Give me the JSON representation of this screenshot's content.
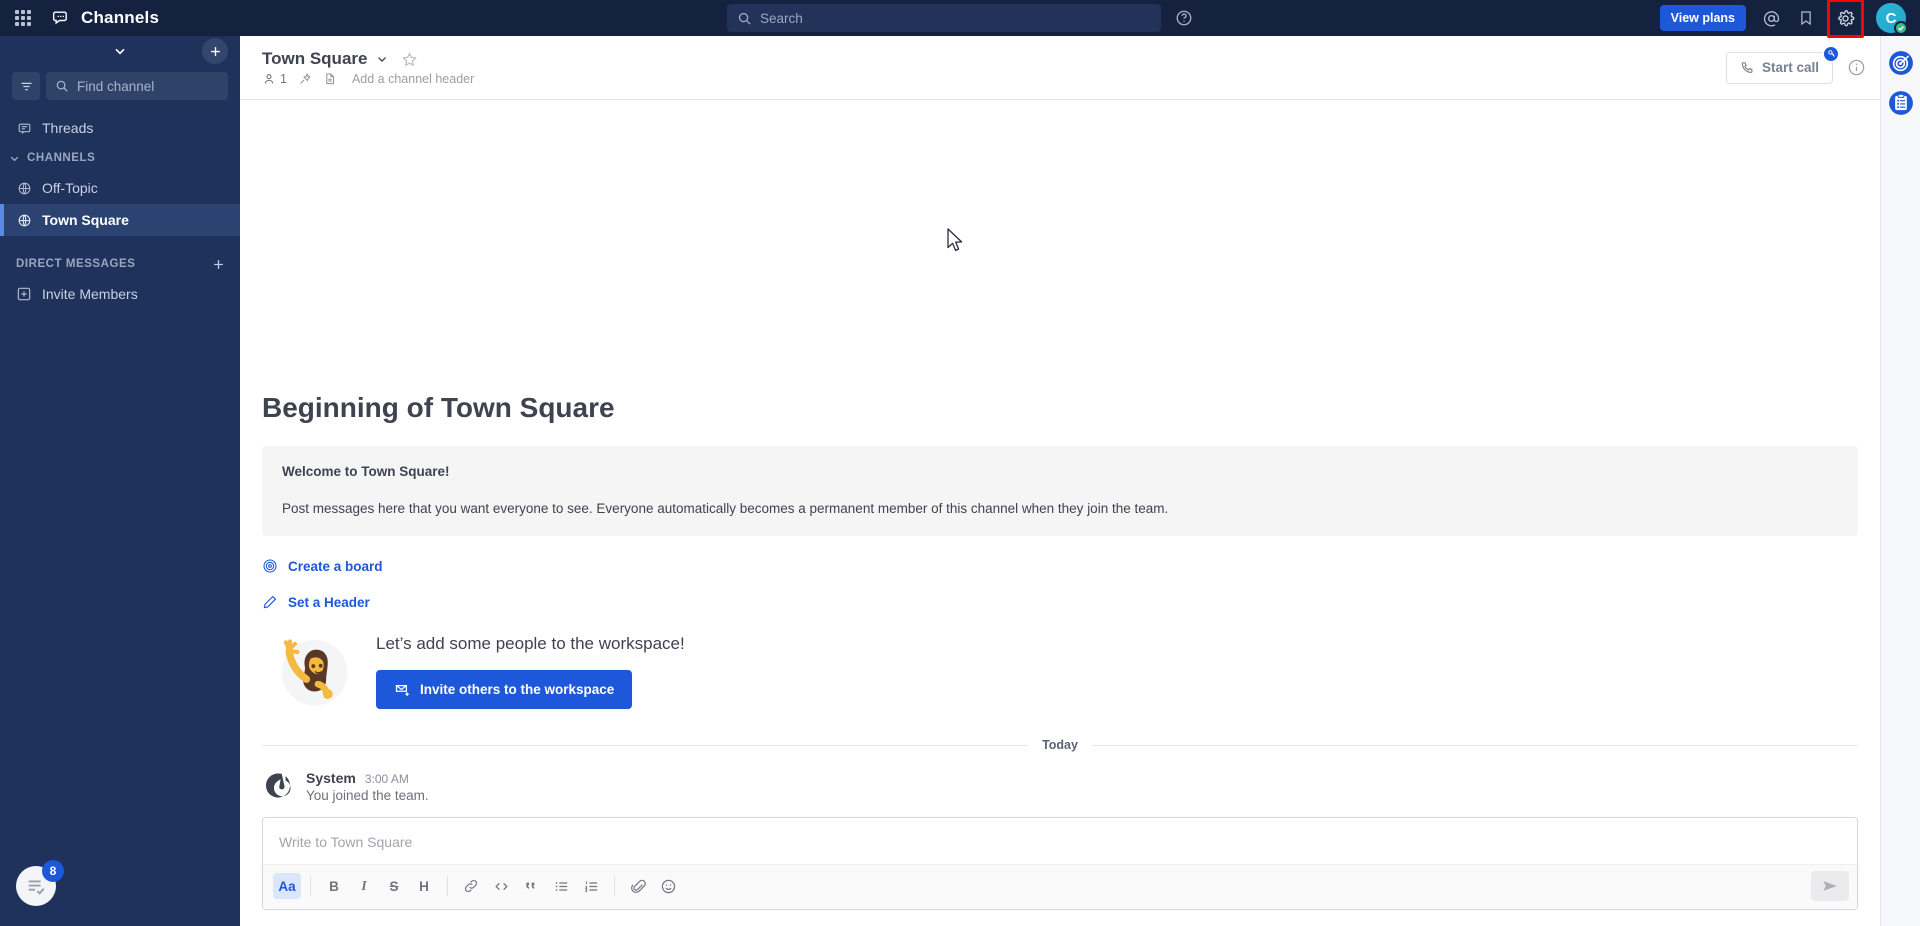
{
  "global_header": {
    "product_name": "Channels",
    "grid_icon": "apps-grid-icon",
    "product_icon": "channels-icon",
    "search_placeholder": "Search",
    "search_icon": "search-icon",
    "help_icon": "help-circle-icon",
    "view_plans_label": "View plans",
    "mention_icon": "at-mention-icon",
    "saved_icon": "bookmark-icon",
    "settings_icon": "gear-icon",
    "avatar_initial": "C",
    "status": "online",
    "accent_color": "#1c58d9",
    "background_color": "#14213f",
    "highlight_color": "#ff0000"
  },
  "sidebar": {
    "collapse_icon": "chevron-down-icon",
    "add_icon": "plus-icon",
    "filter_icon": "filter-icon",
    "find_channel_placeholder": "Find channel",
    "find_channel_icon": "search-icon",
    "threads": {
      "label": "Threads",
      "icon": "threads-icon"
    },
    "categories": [
      {
        "label": "CHANNELS",
        "chevron_icon": "chevron-down-icon",
        "has_plus": false,
        "items": [
          {
            "label": "Off-Topic",
            "icon": "globe-icon",
            "active": false
          },
          {
            "label": "Town Square",
            "icon": "globe-icon",
            "active": true
          }
        ]
      },
      {
        "label": "DIRECT MESSAGES",
        "chevron_icon": "",
        "has_plus": true,
        "plus_icon": "plus-icon",
        "items": [
          {
            "label": "Invite Members",
            "icon": "invite-plus-box-icon",
            "active": false
          }
        ]
      }
    ],
    "bottom_badge": {
      "count": "8",
      "icon": "checklist-icon"
    },
    "background_color": "#1e325c",
    "active_color": "#2c4372"
  },
  "channel_header": {
    "name": "Town Square",
    "chevron_icon": "chevron-down-icon",
    "favorite_icon": "star-outline-icon",
    "member_icon": "member-icon",
    "member_count": "1",
    "pinned_icon": "pin-icon",
    "files_icon": "file-icon",
    "add_header_label": "Add a channel header",
    "start_call_label": "Start call",
    "start_call_icon": "phone-icon",
    "pro_badge_icon": "professional-key-icon",
    "info_icon": "info-circle-icon"
  },
  "main": {
    "intro_title": "Beginning of Town Square",
    "welcome_heading": "Welcome to Town Square!",
    "welcome_body": "Post messages here that you want everyone to see. Everyone automatically becomes a permanent member of this channel when they join the team.",
    "actions": [
      {
        "label": "Create a board",
        "icon": "board-target-icon"
      },
      {
        "label": "Set a Header",
        "icon": "pencil-icon"
      }
    ],
    "invite": {
      "title": "Let’s add some people to the workspace!",
      "button_label": "Invite others to the workspace",
      "button_icon": "invite-envelope-icon",
      "illustration": "person-waving-illustration"
    },
    "date_separator": "Today",
    "posts": [
      {
        "author": "System",
        "time": "3:00 AM",
        "text": "You joined the team.",
        "avatar_icon": "mattermost-logo-icon"
      }
    ]
  },
  "composer": {
    "placeholder": "Write to Town Square",
    "toolbar": [
      {
        "name": "formatting-toggle",
        "label": "Aa",
        "icon": "text-format-icon",
        "active": true
      },
      {
        "name": "bold",
        "label": "B",
        "icon": "bold-icon",
        "active": false
      },
      {
        "name": "italic",
        "label": "I",
        "icon": "italic-icon",
        "active": false
      },
      {
        "name": "strikethrough",
        "label": "S",
        "icon": "strikethrough-icon",
        "active": false
      },
      {
        "name": "heading",
        "label": "H",
        "icon": "heading-icon",
        "active": false
      },
      {
        "name": "link",
        "label": "",
        "icon": "link-icon",
        "active": false
      },
      {
        "name": "code",
        "label": "",
        "icon": "code-icon",
        "active": false
      },
      {
        "name": "quote",
        "label": "",
        "icon": "quote-icon",
        "active": false
      },
      {
        "name": "bulleted-list",
        "label": "",
        "icon": "bulleted-list-icon",
        "active": false
      },
      {
        "name": "numbered-list",
        "label": "",
        "icon": "numbered-list-icon",
        "active": false
      },
      {
        "name": "attachment",
        "label": "",
        "icon": "paperclip-icon",
        "active": false
      },
      {
        "name": "emoji",
        "label": "",
        "icon": "emoji-smile-icon",
        "active": false
      }
    ],
    "send_icon": "send-plane-icon"
  },
  "app_bar": {
    "items": [
      {
        "name": "playbooks",
        "icon": "playbooks-target-icon",
        "color": "#1c58d9"
      },
      {
        "name": "boards",
        "icon": "boards-clipboard-icon",
        "color": "#1c58d9"
      }
    ]
  }
}
